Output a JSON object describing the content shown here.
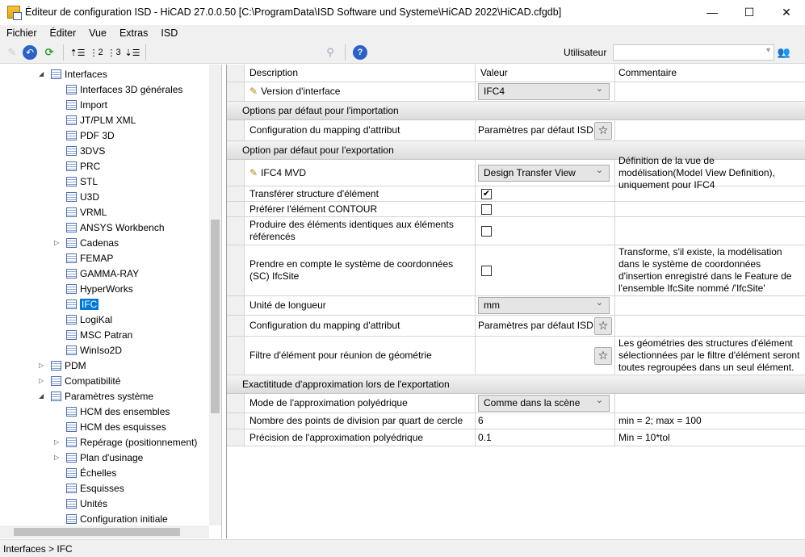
{
  "window": {
    "title": "Éditeur de configuration ISD  - HiCAD 27.0.0.50 [C:\\ProgramData\\ISD Software und Systeme\\HiCAD 2022\\HiCAD.cfgdb]"
  },
  "menu": [
    "Fichier",
    "Éditer",
    "Vue",
    "Extras",
    "ISD"
  ],
  "toolbar": {
    "user_label": "Utilisateur",
    "user_value": "",
    "level2": "2",
    "level3": "3"
  },
  "tree": [
    {
      "label": "Interfaces",
      "level": 0,
      "arrow": "expanded"
    },
    {
      "label": "Interfaces 3D générales",
      "level": 1
    },
    {
      "label": "Import",
      "level": 1
    },
    {
      "label": "JT/PLM XML",
      "level": 1
    },
    {
      "label": "PDF 3D",
      "level": 1
    },
    {
      "label": "3DVS",
      "level": 1
    },
    {
      "label": "PRC",
      "level": 1
    },
    {
      "label": "STL",
      "level": 1
    },
    {
      "label": "U3D",
      "level": 1
    },
    {
      "label": "VRML",
      "level": 1
    },
    {
      "label": "ANSYS Workbench",
      "level": 1
    },
    {
      "label": "Cadenas",
      "level": 1,
      "arrow": "collapsed"
    },
    {
      "label": "FEMAP",
      "level": 1
    },
    {
      "label": "GAMMA-RAY",
      "level": 1
    },
    {
      "label": "HyperWorks",
      "level": 1
    },
    {
      "label": "IFC",
      "level": 1,
      "selected": true
    },
    {
      "label": "LogiKal",
      "level": 1
    },
    {
      "label": "MSC Patran",
      "level": 1
    },
    {
      "label": "WinIso2D",
      "level": 1
    },
    {
      "label": "PDM",
      "level": 0,
      "arrow": "collapsed"
    },
    {
      "label": "Compatibilité",
      "level": 0,
      "arrow": "collapsed"
    },
    {
      "label": "Paramètres système",
      "level": 0,
      "arrow": "expanded"
    },
    {
      "label": "HCM des ensembles",
      "level": 1
    },
    {
      "label": "HCM des esquisses",
      "level": 1
    },
    {
      "label": "Repérage (positionnement)",
      "level": 1,
      "arrow": "collapsed"
    },
    {
      "label": "Plan d'usinage",
      "level": 1,
      "arrow": "collapsed"
    },
    {
      "label": "Échelles",
      "level": 1
    },
    {
      "label": "Esquisses",
      "level": 1
    },
    {
      "label": "Unités",
      "level": 1
    },
    {
      "label": "Configuration initiale",
      "level": 1
    }
  ],
  "grid": {
    "headers": [
      "Description",
      "Valeur",
      "Commentaire"
    ],
    "rows": [
      {
        "type": "row",
        "desc": "Version d'interface",
        "pencil": true,
        "value": "IFC4",
        "kind": "combo",
        "comment": ""
      },
      {
        "type": "group",
        "label": "Options par défaut pour l'importation"
      },
      {
        "type": "row",
        "desc": "Configuration du mapping d'attribut",
        "value": "Paramètres par défaut ISD",
        "kind": "star",
        "comment": ""
      },
      {
        "type": "group",
        "label": "Option par défaut pour l'exportation"
      },
      {
        "type": "row",
        "desc": "IFC4 MVD",
        "pencil": true,
        "value": "Design Transfer View",
        "kind": "combo",
        "comment": "Définition de la vue de modélisation(Model View Definition), uniquement pour IFC4"
      },
      {
        "type": "row",
        "desc": "Transférer structure d'élément",
        "value": true,
        "kind": "check",
        "comment": ""
      },
      {
        "type": "row",
        "desc": "Préférer l'élément CONTOUR",
        "value": false,
        "kind": "check",
        "comment": ""
      },
      {
        "type": "row",
        "desc": "Produire des éléments identiques aux éléments référencés",
        "value": false,
        "kind": "check",
        "comment": ""
      },
      {
        "type": "row",
        "desc": "Prendre en compte le système de coordonnées (SC) IfcSite",
        "value": false,
        "kind": "check",
        "comment": "Transforme, s'il existe, la modélisation dans le système de coordonnées d'insertion enregistré dans le Feature de l'ensemble IfcSite nommé /'IfcSite'"
      },
      {
        "type": "row",
        "desc": "Unité de longueur",
        "value": "mm",
        "kind": "combo",
        "comment": ""
      },
      {
        "type": "row",
        "desc": "Configuration du mapping d'attribut",
        "value": "Paramètres par défaut ISD",
        "kind": "star",
        "comment": ""
      },
      {
        "type": "row",
        "desc": "Filtre d'élément pour réunion de géométrie",
        "value": "",
        "kind": "star",
        "comment": "Les géométries des structures d'élément sélectionnées par le filtre d'élément seront toutes regroupées dans un seul élément."
      },
      {
        "type": "group",
        "label": "Exactititude d'approximation lors de l'exportation"
      },
      {
        "type": "row",
        "desc": "Mode de l'approximation polyédrique",
        "value": "Comme dans la scène",
        "kind": "combo",
        "comment": ""
      },
      {
        "type": "row",
        "desc": "Nombre des points de division par quart de cercle",
        "value": "6",
        "kind": "text",
        "comment": "min = 2; max = 100"
      },
      {
        "type": "row",
        "desc": "Précision de l'approximation polyédrique",
        "value": "0.1",
        "kind": "text",
        "comment": "Min = 10*tol"
      }
    ]
  },
  "status": "Interfaces > IFC"
}
